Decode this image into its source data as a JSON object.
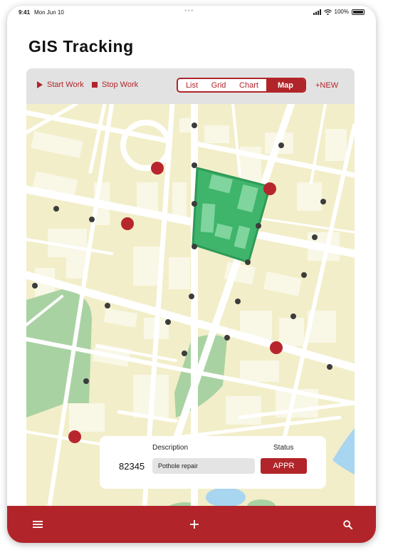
{
  "status_bar": {
    "time": "9:41",
    "date": "Mon Jun 10",
    "battery": "100%"
  },
  "page_title": "GIS Tracking",
  "toolbar": {
    "start_work": "Start Work",
    "stop_work": "Stop Work",
    "views": [
      "List",
      "Grid",
      "Chart",
      "Map"
    ],
    "active_view": "Map",
    "new_button": "+NEW"
  },
  "map": {
    "highlight_color": "#3fb46b",
    "marker_color": "#b7262c",
    "waypoint_color": "#3c3c3c"
  },
  "info_panel": {
    "description_header": "Description",
    "status_header": "Status",
    "id": "82345",
    "description": "Pothole repair",
    "status": "APPR"
  },
  "bottom_bar": {
    "icons": [
      "menu-icon",
      "add-icon",
      "search-icon"
    ]
  },
  "colors": {
    "accent": "#b1252a",
    "map_background": "#f2eec9",
    "park": "#a9d2a2",
    "water": "#a8d5ef"
  }
}
